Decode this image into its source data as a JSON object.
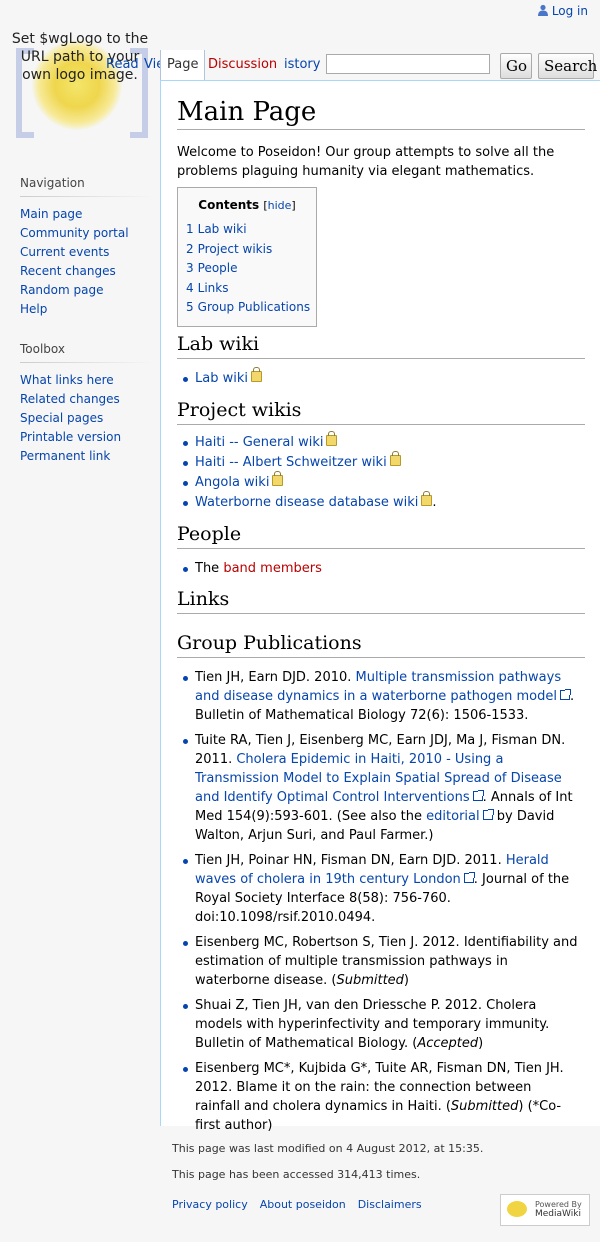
{
  "personal": {
    "login_label": "Log in",
    "icon": "user-icon"
  },
  "logo": {
    "text": "Set $wgLogo to the URL path to your own logo image."
  },
  "tabs": [
    {
      "label": "Read"
    },
    {
      "label": "View"
    },
    {
      "label": "Page"
    },
    {
      "label": "Discussion"
    },
    {
      "label": "istory"
    }
  ],
  "search": {
    "placeholder": "",
    "go_label": "Go",
    "search_label": "Search"
  },
  "sidebar": {
    "navigation_title": "Navigation",
    "navigation": [
      "Main page",
      "Community portal",
      "Current events",
      "Recent changes",
      "Random page",
      "Help"
    ],
    "toolbox_title": "Toolbox",
    "toolbox": [
      "What links here",
      "Related changes",
      "Special pages",
      "Printable version",
      "Permanent link"
    ]
  },
  "page": {
    "title": "Main Page",
    "intro": "Welcome to Poseidon! Our group attempts to solve all the problems plaguing humanity via elegant mathematics.",
    "toc": {
      "title": "Contents",
      "hide_label": "hide",
      "items": [
        {
          "num": "1",
          "label": "Lab wiki"
        },
        {
          "num": "2",
          "label": "Project wikis"
        },
        {
          "num": "3",
          "label": "People"
        },
        {
          "num": "4",
          "label": "Links"
        },
        {
          "num": "5",
          "label": "Group Publications"
        }
      ]
    },
    "sections": {
      "lab_wiki": {
        "heading": "Lab wiki",
        "items": [
          "Lab wiki"
        ]
      },
      "project_wikis": {
        "heading": "Project wikis",
        "items": [
          "Haiti -- General wiki",
          "Haiti -- Albert Schweitzer wiki",
          "Angola wiki",
          "Waterborne disease database wiki"
        ],
        "trailing_period": "."
      },
      "people": {
        "heading": "People",
        "prefix": "The ",
        "link": "band members"
      },
      "links": {
        "heading": "Links"
      },
      "publications": {
        "heading": "Group Publications",
        "items": [
          {
            "pre": "Tien JH, Earn DJD. 2010. ",
            "link": "Multiple transmission pathways and disease dynamics in a waterborne pathogen model",
            "post": ". Bulletin of Mathematical Biology 72(6): 1506-1533."
          },
          {
            "pre": "Tuite RA, Tien J, Eisenberg MC, Earn JDJ, Ma J, Fisman DN. 2011. ",
            "link": "Cholera Epidemic in Haiti, 2010 - Using a Transmission Model to Explain Spatial Spread of Disease and Identify Optimal Control Interventions",
            "post": ". Annals of Int Med 154(9):593-601. (See also the ",
            "link2": "editorial",
            "post2": " by David Walton, Arjun Suri, and Paul Farmer.)"
          },
          {
            "pre": "Tien JH, Poinar HN, Fisman DN, Earn DJD. 2011. ",
            "link": "Herald waves of cholera in 19th century London",
            "post": ". Journal of the Royal Society Interface 8(58): 756-760. doi:10.1098/rsif.2010.0494."
          },
          {
            "pre": "Eisenberg MC, Robertson S, Tien J. 2012. Identifiability and estimation of multiple transmission pathways in waterborne disease. (",
            "em": "Submitted",
            "post": ")"
          },
          {
            "pre": "Shuai Z, Tien JH, van den Driessche P. 2012. Cholera models with hyperinfectivity and temporary immunity. Bulletin of Mathematical Biology. (",
            "em": "Accepted",
            "post": ")"
          },
          {
            "pre": "Eisenberg MC*, Kujbida G*, Tuite AR, Fisman DN, Tien JH. 2012. Blame it on the rain: the connection between rainfall and cholera dynamics in Haiti. (",
            "em": "Submitted",
            "post": ") (*Co-first author)"
          }
        ]
      }
    }
  },
  "footer": {
    "modified": "This page was last modified on 4 August 2012, at 15:35.",
    "accessed": "This page has been accessed 314,413 times.",
    "links": [
      "Privacy policy",
      "About poseidon",
      "Disclaimers"
    ],
    "powered_top": "Powered By",
    "powered_name": "MediaWiki"
  }
}
